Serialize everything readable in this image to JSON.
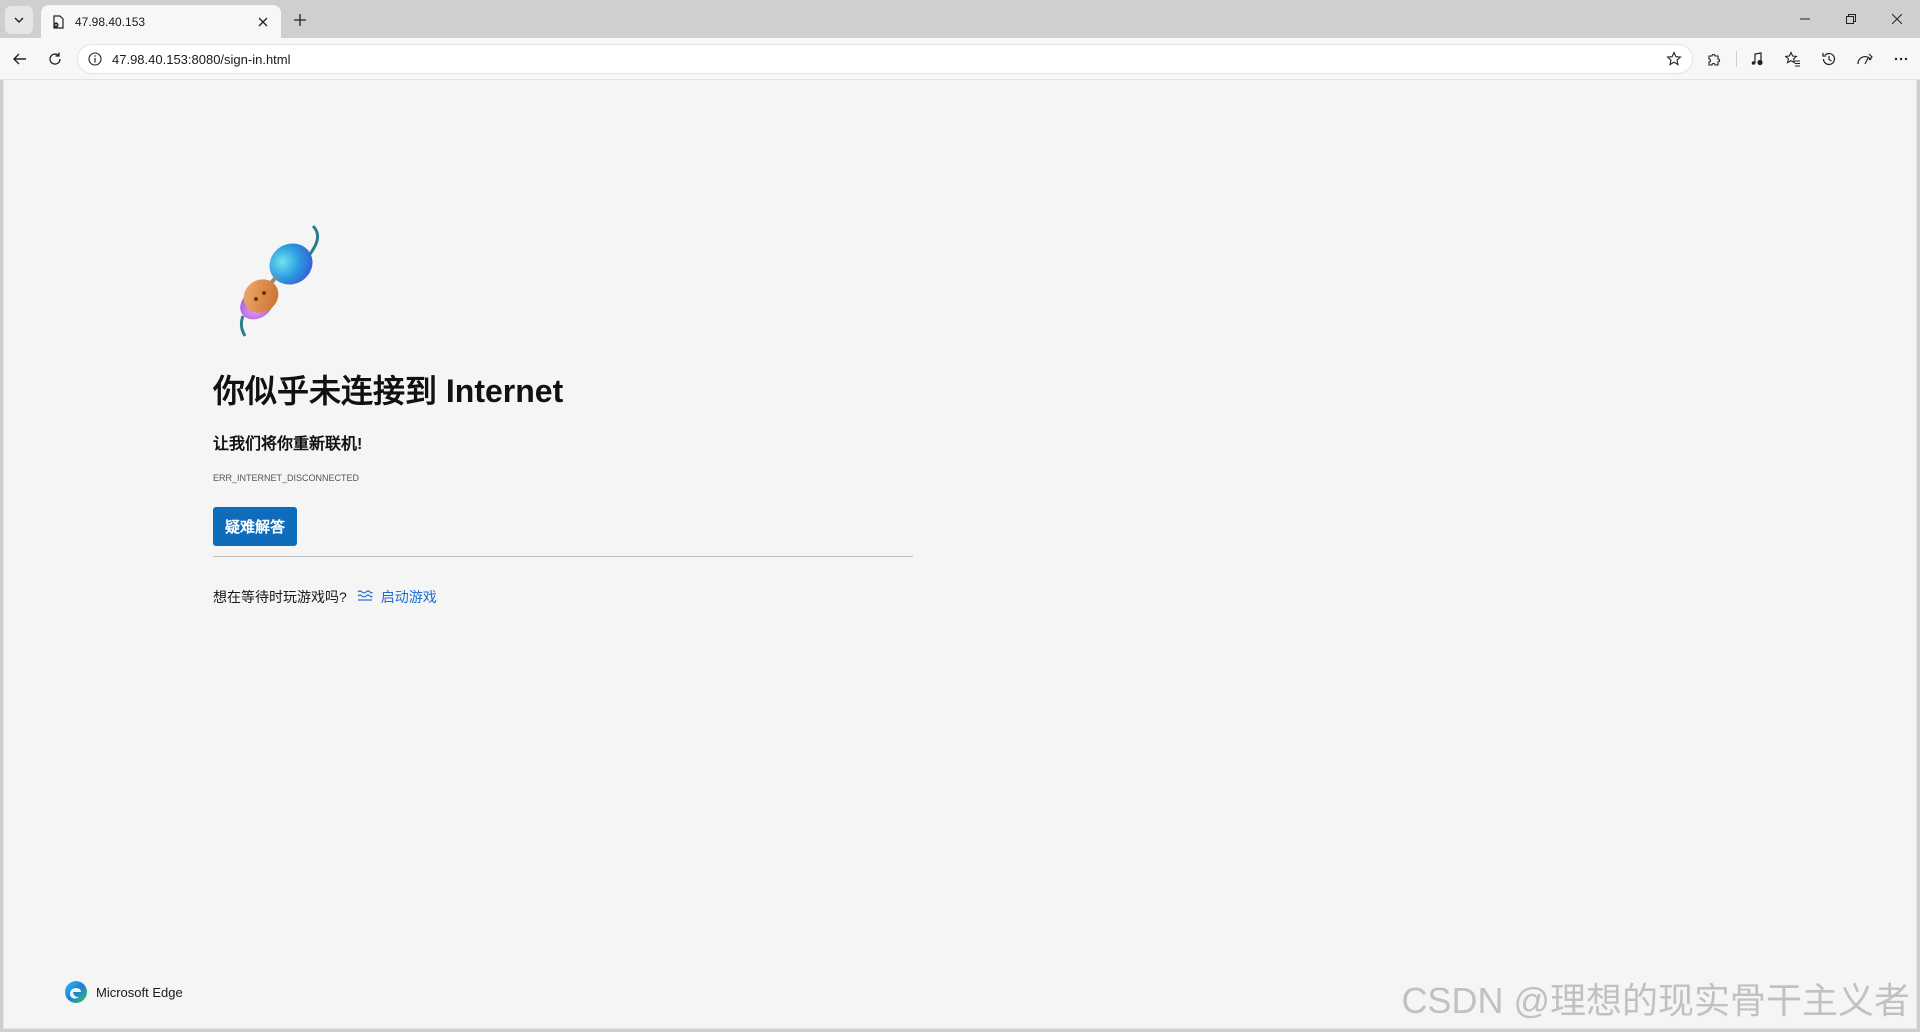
{
  "tab": {
    "title": "47.98.40.153"
  },
  "toolbar": {
    "url": "47.98.40.153:8080/sign-in.html"
  },
  "page": {
    "title": "你似乎未连接到 Internet",
    "subtitle": "让我们将你重新联机!",
    "error_code": "ERR_INTERNET_DISCONNECTED",
    "help_button": "疑难解答",
    "game_prompt": "想在等待时玩游戏吗?",
    "game_link": "启动游戏"
  },
  "footer": {
    "brand": "Microsoft Edge"
  },
  "watermark": "CSDN @理想的现实骨干主义者",
  "colors": {
    "accent": "#0f6cbd",
    "link": "#1a6fd1",
    "page_bg": "#f5f5f6",
    "frame_bg": "#cfcfcf"
  },
  "icons": [
    "chevron-down-icon",
    "page-icon",
    "close-icon",
    "plus-icon",
    "minimize-icon",
    "restore-icon",
    "back-icon",
    "refresh-icon",
    "info-icon",
    "star-icon",
    "extensions-icon",
    "media-icon",
    "favorites-icon",
    "history-icon",
    "performance-icon",
    "more-icon",
    "game-waves-icon",
    "edge-logo-icon"
  ]
}
